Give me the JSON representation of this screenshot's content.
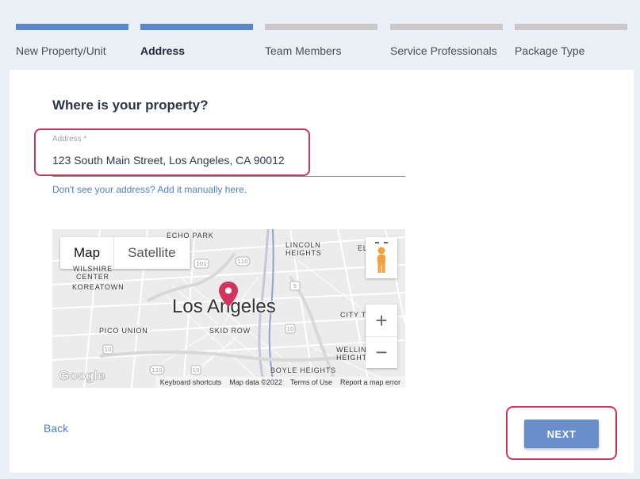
{
  "stepper": {
    "steps": [
      {
        "label": "New Property/Unit",
        "state": "done"
      },
      {
        "label": "Address",
        "state": "active"
      },
      {
        "label": "Team Members",
        "state": "todo"
      },
      {
        "label": "Service Professionals",
        "state": "todo"
      },
      {
        "label": "Package Type",
        "state": "todo"
      }
    ]
  },
  "form": {
    "heading": "Where is your property?",
    "address_label": "Address *",
    "address_value": "123 South Main Street, Los Angeles, CA 90012",
    "manual_link": "Don't see your address? Add it manually here."
  },
  "map": {
    "type_options": [
      "Map",
      "Satellite"
    ],
    "selected_type": "Map",
    "city_label": "Los Angeles",
    "area_labels": [
      "ECHO PARK",
      "LINCOLN\nHEIGHTS",
      "EL",
      "WILSHIRE\nCENTER",
      "KOREATOWN",
      "PICO UNION",
      "SKID ROW",
      "CITY T",
      "WELLIN\nHEIGHTS",
      "BOYLE HEIGHTS"
    ],
    "route_shields": [
      "101",
      "110",
      "5",
      "10",
      "10",
      "110",
      "10"
    ],
    "zoom_in": "+",
    "zoom_out": "−",
    "logo": "Google",
    "footer": [
      "Keyboard shortcuts",
      "Map data ©2022",
      "Terms of Use",
      "Report a map error"
    ],
    "pin_color": "#d0355d"
  },
  "nav": {
    "back_label": "Back",
    "next_label": "NEXT"
  },
  "colors": {
    "accent": "#5b86c9",
    "highlight": "#c8375a",
    "link": "#4f7fc4"
  }
}
